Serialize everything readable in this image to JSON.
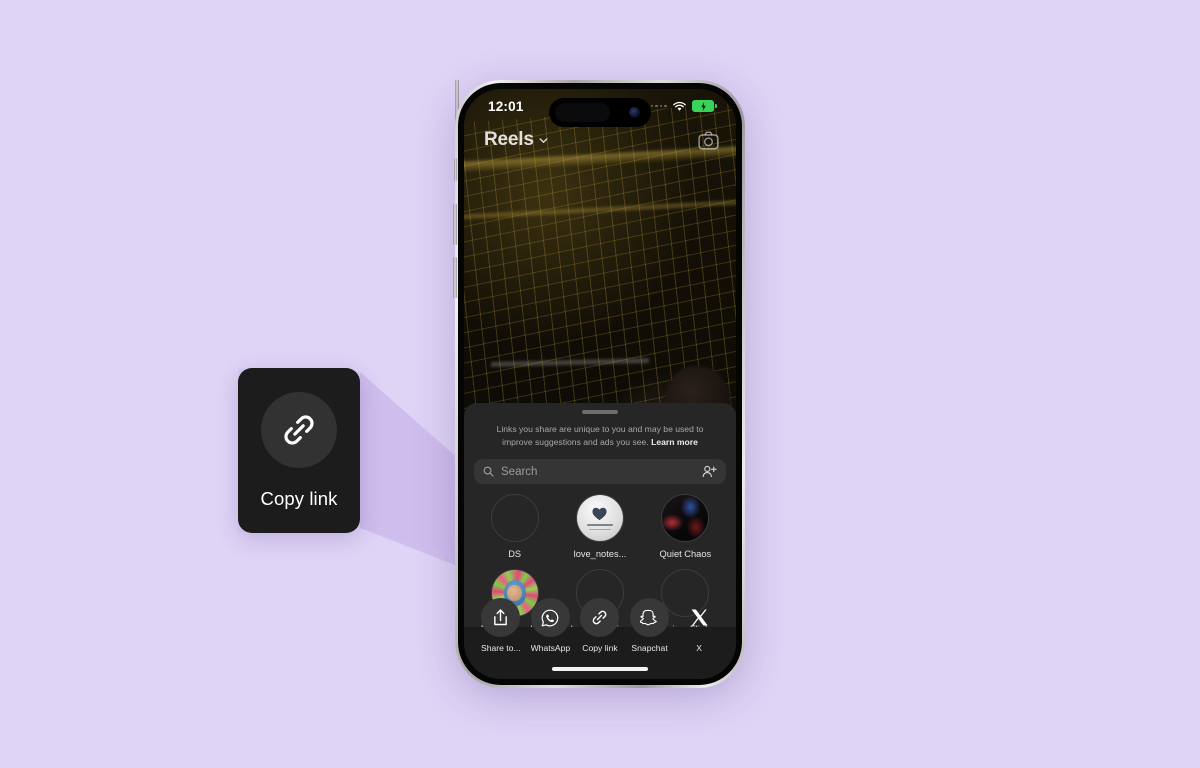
{
  "background_color": "#ded4f6",
  "callout": {
    "icon": "link-icon",
    "label": "Copy link",
    "card_color": "#1c1c1c",
    "circle_color": "#323232"
  },
  "phone": {
    "status_bar": {
      "time": "12:01",
      "signal_icon": "cellular-dots-icon",
      "wifi_icon": "wifi-icon",
      "battery_icon": "battery-charging-icon",
      "battery_color": "#3ad35a"
    },
    "home_indicator": "home-indicator"
  },
  "reels": {
    "title": "Reels",
    "chevron_icon": "chevron-down-icon",
    "camera_icon": "camera-icon"
  },
  "share_sheet": {
    "grabber": "drag-handle",
    "disclaimer_text": "Links you share are unique to you and may be used to improve suggestions and ads you see.",
    "disclaimer_link": "Learn more",
    "search": {
      "icon": "search-icon",
      "placeholder": "Search",
      "value": "",
      "add_people_icon": "add-person-icon"
    },
    "contacts": [
      {
        "name": "DS",
        "avatar": "empty"
      },
      {
        "name": "love_notes...",
        "avatar": "lovenotes"
      },
      {
        "name": "Quiet Chaos",
        "avatar": "quietchaos"
      },
      {
        "name": "Becca Blasdel",
        "avatar": "becca",
        "verified": true
      },
      {
        "name": "beccamagrino",
        "avatar": "empty"
      },
      {
        "name": "Anime Fliek",
        "avatar": "empty"
      }
    ],
    "actions": [
      {
        "label": "Share to...",
        "icon": "share-up-icon"
      },
      {
        "label": "WhatsApp",
        "icon": "whatsapp-icon"
      },
      {
        "label": "Copy link",
        "icon": "link-icon"
      },
      {
        "label": "Snapchat",
        "icon": "snapchat-icon"
      },
      {
        "label": "X",
        "icon": "x-icon"
      }
    ]
  }
}
